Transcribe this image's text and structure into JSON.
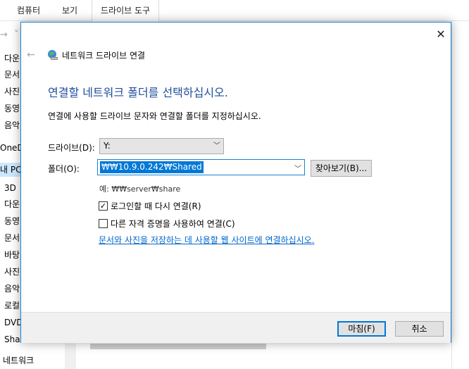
{
  "ribbon": {
    "tabs": [
      "컴퓨터",
      "보기",
      "드라이브 도구"
    ]
  },
  "sidebar": {
    "items": [
      "다운",
      "문서",
      "사진",
      "동영",
      "음악",
      "OneD",
      "내 PC",
      "3D",
      "다운",
      "동영",
      "문서",
      "바탕",
      "사진",
      "음악",
      "로컬",
      "DVD",
      "Shar"
    ],
    "bottom": "네트워크"
  },
  "dialog": {
    "window_title": "네트워크 드라이브 연결",
    "heading": "연결할 네트워크 폴더를 선택하십시오.",
    "instruction": "연결에 사용할 드라이브 문자와 연결할 폴더를 지정하십시오.",
    "drive_label": "드라이브(D):",
    "drive_value": "Y:",
    "folder_label": "폴더(O):",
    "folder_value": "₩₩10.9.0.242₩Shared",
    "browse_label": "찾아보기(B)...",
    "example": "예: ₩₩server₩share",
    "reconnect_label": "로그인할 때 다시 연결(R)",
    "reconnect_checked": true,
    "credentials_label": "다른 자격 증명을 사용하여 연결(C)",
    "credentials_checked": false,
    "link_text": "문서와 사진을 저장하는 데 사용할 웹 사이트에 연결하십시오.",
    "finish_label": "마침(F)",
    "cancel_label": "취소"
  },
  "colors": {
    "heading": "#1f4e9c",
    "link": "#0066cc",
    "selection": "#0078d7",
    "dialog_border": "#1883d7"
  }
}
